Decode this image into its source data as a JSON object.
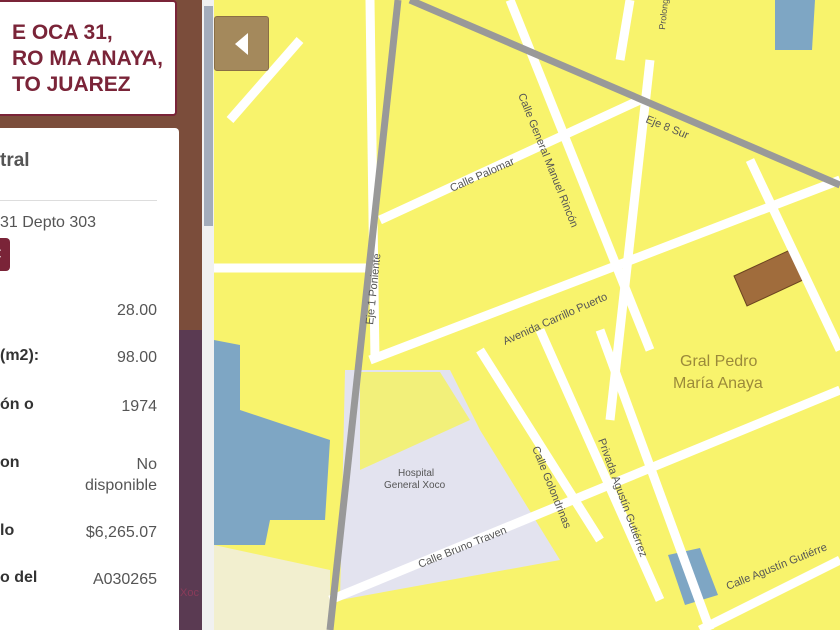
{
  "panel": {
    "title_lines": [
      "E OCA 31,",
      "RO MA ANAYA,",
      "TO JUAREZ"
    ],
    "card_heading": "tral",
    "address": "31 Depto 303",
    "close_label": "✖",
    "rows": [
      {
        "label": "",
        "value": "28.00"
      },
      {
        "label": "(m2):",
        "value": "98.00"
      },
      {
        "label": "ón o",
        "value": "1974"
      },
      {
        "label": "on",
        "value": "No disponible"
      },
      {
        "label": "lo",
        "value": "$6,265.07"
      },
      {
        "label": "o del",
        "value": "A030265"
      }
    ]
  },
  "map": {
    "labels": {
      "eje8": "Eje 8 Sur",
      "eje1": "Eje 1 Poniente",
      "palomar": "Calle Palomar",
      "rincon": "Calle General Manuel Rincón",
      "carrillo": "Avenida Carrillo Puerto",
      "colonia1": "Gral Pedro",
      "colonia2": "María Anaya",
      "hospital1": "Hospital",
      "hospital2": "General Xoco",
      "golondrinas": "Calle Golondrinas",
      "gutierrez": "Privada Agustín Gutiérrez",
      "traven": "Calle Bruno Traven",
      "agustin": "Calle Agustín Gutiérre",
      "prolong": "Prolongación",
      "xoco": "Xoc"
    },
    "colors": {
      "land": "#f8f36c",
      "water": "#7ea6c4",
      "parcel": "#a06c3c"
    }
  }
}
